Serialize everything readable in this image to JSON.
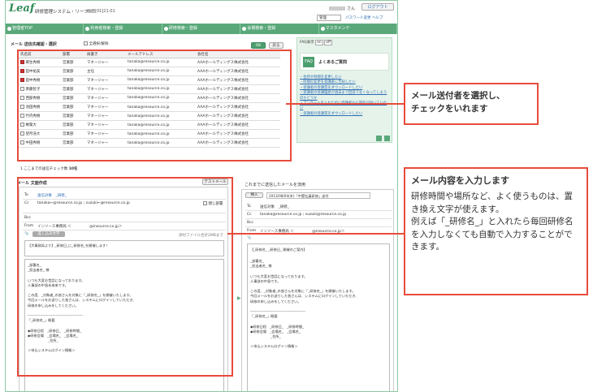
{
  "header": {
    "logo": "Leaf",
    "system_name": "研修管理システム・リーフ・",
    "screen_id": "画面[01]21-01",
    "user_suffix": "さん",
    "logout_label": "ログアウト",
    "role_value": "管理",
    "password_link": "パスワード変更",
    "help_link": "ヘルプ"
  },
  "nav": {
    "tabs": [
      "管理者TOP",
      "利用者検索・登録",
      "研修検索・登録",
      "会場検索・登録",
      "マスタメンテ"
    ]
  },
  "recipients": {
    "section_title": "メール 送信先確認・選択",
    "select_all_label": "全選択/解除",
    "ok_label": "OK",
    "back_label": "戻る",
    "columns": [
      "氏名前",
      "部署",
      "肩書き",
      "メールアドレス",
      "会社名"
    ],
    "rows": [
      {
        "name": "麻生秀樹",
        "dept": "営業部",
        "title": "マネージャー",
        "email": "tanaka@resource.co.jp",
        "company": "AAAホールディングス株式会社",
        "checked": true
      },
      {
        "name": "田中祐美",
        "dept": "営業部",
        "title": "主任",
        "email": "tanaka@resource.co.jp",
        "company": "AAAホールディングス株式会社",
        "checked": true
      },
      {
        "name": "田中秀樹",
        "dept": "営業部",
        "title": "マネージャー",
        "email": "tanaka@resource.co.jp",
        "company": "AAAホールディングス株式会社",
        "checked": true
      },
      {
        "name": "斎藤智子",
        "dept": "営業部",
        "title": "マネージャー",
        "email": "tanaka@resource.co.jp",
        "company": "AAAホールディングス株式会社",
        "checked": false
      },
      {
        "name": "西部秀樹",
        "dept": "営業部",
        "title": "マネージャー",
        "email": "tanaka@resource.co.jp",
        "company": "AAAホールディングス株式会社",
        "checked": false
      },
      {
        "name": "池田秀樹",
        "dept": "営業部",
        "title": "マネージャー",
        "email": "tanaka@resource.co.jp",
        "company": "AAAホールディングス株式会社",
        "checked": false
      },
      {
        "name": "竹内秀樹",
        "dept": "営業部",
        "title": "マネージャー",
        "email": "tanaka@resource.co.jp",
        "company": "AAAホールディングス株式会社",
        "checked": false
      },
      {
        "name": "榊葉大",
        "dept": "営業部",
        "title": "マネージャー",
        "email": "tanaka@resource.co.jp",
        "company": "AAAホールディングス株式会社",
        "checked": false
      },
      {
        "name": "望月浩大",
        "dept": "営業部",
        "title": "マネージャー",
        "email": "tanaka@resource.co.jp",
        "company": "AAAホールディングス株式会社",
        "checked": false
      },
      {
        "name": "中田秀樹",
        "dept": "営業部",
        "title": "マネージャー",
        "email": "tanaka@resource.co.jp",
        "company": "AAAホールディングス株式会社",
        "checked": false
      }
    ],
    "checked_count_label": "1.ここまでの送信チェック数",
    "checked_count": "10名"
  },
  "faq": {
    "display_label": "FAQ表示",
    "on": "on",
    "off": "off",
    "box_label": "FAQ",
    "box_title": "よくあるご質問",
    "items": [
      "・住所や時間を変更したい",
      "・時間の変更を受講者に告知したい",
      "・受講者の受講票をダウンロードしたい",
      "・受講者の受講履歴が過去まで回答でなくなってしまうのかどうか",
      "・アンケートを入れたのに受講者から回答が届いていない",
      "・受講者の受講票をダウンロードしたい"
    ]
  },
  "compose": {
    "section_title": "メール 文面作成",
    "test_mail_label": "テストメール",
    "to_label": "To",
    "to_value": "送信対象　_研修_",
    "cc_label": "Cc",
    "cc_value": "tanaka←@resource.co.jp ; suzuki←@resource.co.jp",
    "hide_dept_label": "閉じ部署",
    "bcc_label": "Bcc",
    "from_label": "From",
    "from_value": "インソース事務局 ＜　　　　　@insource.co.jp＞",
    "insert_label": "差し込み文字",
    "attach_note": "添付ファイル合計2MBまで",
    "subject": "【大事務局より】_研修日_に_研修名_を開催します！",
    "body": "_部署名_\n_担当者名_ 様\n\nいつも大変お世話になっております。\n人事部の中島未来来です。\n\nこの度、_対象者_の皆さんを対象に「_研修名_」を開催いたします。\n今回メールをお送りした皆さんは、システムにログインしていただき、\n研修の申し込みをしてください。\n\n---------------------------------------------\n「_研修名_」概要\n\n◆研修日程　_研修日_　_研修時間_\n◆研修会場　_会場名_　_会場名_\n　　　　　　_住所_\n\n＜申込システムログイン情報＞"
  },
  "sent": {
    "section_title": "これまでに送信したメールを流用",
    "insert_label": "挿入",
    "select_value": "2013/08/04(木)「中堅社員研修」送付",
    "to_label": "To",
    "to_value": "送信対象　_研修_",
    "cc_label": "Cc",
    "cc_value": "tanaka@resource.co.jp ; suzuki@resource.co.jp",
    "bcc_label": "Bcc",
    "from_label": "From",
    "from_value": "インソース事務局 ＜　　　　　@insource.co.jp＞",
    "subject": "【_研修名_ _研修日_ 開催のご案内】",
    "body": "_部署名_\n_担当者名_ 様\n\nいつも大変お世話になっております。\n人事部の中島です。\n\nこの度、_対象者_の皆さんを対象に「_研修名_」を開催いたします。\n今回メールをお送りした皆さんは、システムにログインしていただき、\n研修の申し込みをしてください。\n\n---------------------------------------------\n「_研修名_」概要\n\n◆研修日程　_研修日_　_研修時間_\n◆研修会場　_会場名_　_会場名_\n　　　　　　_住所_\n\n＜申込システムログイン情報＞"
  },
  "callouts": {
    "c1_line1": "メール送付者を選択し、",
    "c1_line2": "チェックをいれます",
    "c2_title": "メール内容を入力します",
    "c2_desc": "研修時間や場所など、よく使うものは、置き換え文字が使えます。\n例えば「_研修名_」と入れたら毎回研修名を入力しなくても自動で入力することができます。"
  },
  "colors": {
    "accent": "#5aa87a",
    "callout": "#e74c3c",
    "link": "#2e6db4"
  }
}
